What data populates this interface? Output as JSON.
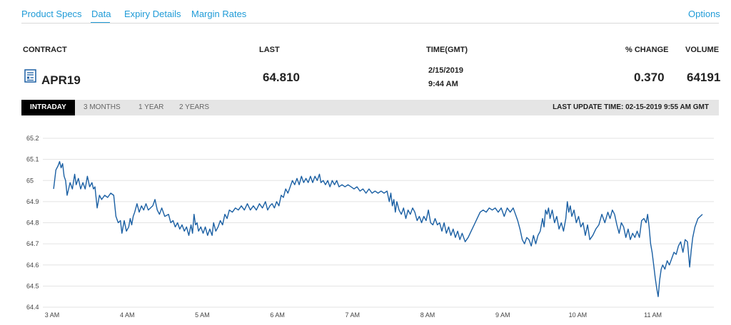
{
  "tabs": [
    {
      "label": "Product Specs"
    },
    {
      "label": "Data",
      "active": true
    },
    {
      "label": "Expiry Details"
    },
    {
      "label": "Margin Rates"
    }
  ],
  "options_label": "Options",
  "table": {
    "headers": {
      "contract": "CONTRACT",
      "last": "LAST",
      "time": "TIME(GMT)",
      "change": "% CHANGE",
      "volume": "VOLUME"
    },
    "row": {
      "contract": "APR19",
      "last": "64.810",
      "date": "2/15/2019",
      "time": "9:44 AM",
      "change": "0.370",
      "volume": "64191"
    },
    "contract_icon": "document-list-icon"
  },
  "ranges": [
    {
      "label": "INTRADAY",
      "active": true
    },
    {
      "label": "3 MONTHS"
    },
    {
      "label": "1 YEAR"
    },
    {
      "label": "2 YEARS"
    }
  ],
  "last_update": "LAST UPDATE TIME: 02-15-2019 9:55 AM GMT",
  "colors": {
    "accent": "#1f9bd7",
    "line": "#1a5fa3",
    "grid": "#e3e3e3"
  },
  "chart_data": {
    "type": "line",
    "y_ticks": [
      "65.2",
      "65.1",
      "65",
      "64.9",
      "64.8",
      "64.7",
      "64.6",
      "64.5",
      "64.4"
    ],
    "x_ticks": [
      "3 AM",
      "4 AM",
      "5 AM",
      "6 AM",
      "7 AM",
      "8 AM",
      "9 AM",
      "10 AM",
      "11 AM"
    ],
    "ylim": [
      64.4,
      65.2
    ],
    "xlim_hours": [
      3.0,
      11.85
    ],
    "grid": "horizontal",
    "series": [
      {
        "points": [
          [
            3.02,
            64.96
          ],
          [
            3.05,
            65.05
          ],
          [
            3.08,
            65.07
          ],
          [
            3.1,
            65.09
          ],
          [
            3.12,
            65.06
          ],
          [
            3.14,
            65.08
          ],
          [
            3.16,
            65.02
          ],
          [
            3.18,
            65.0
          ],
          [
            3.2,
            64.93
          ],
          [
            3.22,
            64.96
          ],
          [
            3.24,
            64.99
          ],
          [
            3.27,
            64.96
          ],
          [
            3.3,
            65.03
          ],
          [
            3.32,
            64.98
          ],
          [
            3.35,
            65.01
          ],
          [
            3.38,
            64.96
          ],
          [
            3.41,
            64.99
          ],
          [
            3.44,
            64.96
          ],
          [
            3.47,
            65.02
          ],
          [
            3.5,
            64.97
          ],
          [
            3.53,
            64.99
          ],
          [
            3.55,
            64.96
          ],
          [
            3.57,
            64.97
          ],
          [
            3.6,
            64.87
          ],
          [
            3.63,
            64.93
          ],
          [
            3.66,
            64.91
          ],
          [
            3.7,
            64.93
          ],
          [
            3.74,
            64.92
          ],
          [
            3.78,
            64.94
          ],
          [
            3.82,
            64.93
          ],
          [
            3.85,
            64.83
          ],
          [
            3.88,
            64.8
          ],
          [
            3.91,
            64.81
          ],
          [
            3.93,
            64.75
          ],
          [
            3.96,
            64.81
          ],
          [
            3.99,
            64.76
          ],
          [
            4.02,
            64.78
          ],
          [
            4.04,
            64.82
          ],
          [
            4.06,
            64.79
          ],
          [
            4.08,
            64.83
          ],
          [
            4.1,
            64.85
          ],
          [
            4.13,
            64.89
          ],
          [
            4.16,
            64.85
          ],
          [
            4.19,
            64.88
          ],
          [
            4.22,
            64.86
          ],
          [
            4.25,
            64.89
          ],
          [
            4.28,
            64.86
          ],
          [
            4.31,
            64.87
          ],
          [
            4.34,
            64.88
          ],
          [
            4.37,
            64.91
          ],
          [
            4.4,
            64.86
          ],
          [
            4.43,
            64.84
          ],
          [
            4.46,
            64.87
          ],
          [
            4.5,
            64.83
          ],
          [
            4.55,
            64.84
          ],
          [
            4.58,
            64.8
          ],
          [
            4.61,
            64.81
          ],
          [
            4.64,
            64.78
          ],
          [
            4.67,
            64.8
          ],
          [
            4.7,
            64.77
          ],
          [
            4.73,
            64.79
          ],
          [
            4.76,
            64.76
          ],
          [
            4.79,
            64.78
          ],
          [
            4.82,
            64.74
          ],
          [
            4.85,
            64.79
          ],
          [
            4.87,
            64.75
          ],
          [
            4.89,
            64.84
          ],
          [
            4.91,
            64.79
          ],
          [
            4.93,
            64.8
          ],
          [
            4.95,
            64.76
          ],
          [
            4.98,
            64.78
          ],
          [
            5.01,
            64.75
          ],
          [
            5.04,
            64.78
          ],
          [
            5.07,
            64.74
          ],
          [
            5.1,
            64.77
          ],
          [
            5.13,
            64.74
          ],
          [
            5.15,
            64.8
          ],
          [
            5.18,
            64.76
          ],
          [
            5.21,
            64.78
          ],
          [
            5.24,
            64.81
          ],
          [
            5.27,
            64.79
          ],
          [
            5.3,
            64.84
          ],
          [
            5.33,
            64.82
          ],
          [
            5.36,
            64.86
          ],
          [
            5.4,
            64.85
          ],
          [
            5.44,
            64.87
          ],
          [
            5.48,
            64.86
          ],
          [
            5.52,
            64.88
          ],
          [
            5.56,
            64.86
          ],
          [
            5.6,
            64.89
          ],
          [
            5.64,
            64.86
          ],
          [
            5.68,
            64.88
          ],
          [
            5.72,
            64.86
          ],
          [
            5.76,
            64.89
          ],
          [
            5.8,
            64.87
          ],
          [
            5.84,
            64.9
          ],
          [
            5.87,
            64.86
          ],
          [
            5.9,
            64.88
          ],
          [
            5.93,
            64.89
          ],
          [
            5.96,
            64.87
          ],
          [
            5.99,
            64.9
          ],
          [
            6.02,
            64.88
          ],
          [
            6.05,
            64.93
          ],
          [
            6.08,
            64.92
          ],
          [
            6.11,
            64.96
          ],
          [
            6.14,
            64.94
          ],
          [
            6.17,
            64.97
          ],
          [
            6.2,
            65.0
          ],
          [
            6.23,
            64.98
          ],
          [
            6.26,
            65.01
          ],
          [
            6.29,
            64.98
          ],
          [
            6.32,
            65.02
          ],
          [
            6.35,
            64.99
          ],
          [
            6.38,
            65.01
          ],
          [
            6.41,
            64.99
          ],
          [
            6.44,
            65.02
          ],
          [
            6.47,
            64.99
          ],
          [
            6.5,
            65.02
          ],
          [
            6.53,
            65.0
          ],
          [
            6.56,
            65.03
          ],
          [
            6.58,
            64.99
          ],
          [
            6.61,
            65.0
          ],
          [
            6.64,
            64.98
          ],
          [
            6.67,
            65.0
          ],
          [
            6.7,
            64.97
          ],
          [
            6.73,
            65.0
          ],
          [
            6.76,
            64.98
          ],
          [
            6.79,
            65.0
          ],
          [
            6.82,
            64.97
          ],
          [
            6.86,
            64.98
          ],
          [
            6.9,
            64.97
          ],
          [
            6.94,
            64.98
          ],
          [
            6.98,
            64.97
          ],
          [
            7.02,
            64.96
          ],
          [
            7.06,
            64.97
          ],
          [
            7.1,
            64.95
          ],
          [
            7.14,
            64.96
          ],
          [
            7.18,
            64.94
          ],
          [
            7.22,
            64.96
          ],
          [
            7.26,
            64.94
          ],
          [
            7.3,
            64.95
          ],
          [
            7.34,
            64.94
          ],
          [
            7.38,
            64.95
          ],
          [
            7.42,
            64.94
          ],
          [
            7.46,
            64.95
          ],
          [
            7.49,
            64.9
          ],
          [
            7.51,
            64.94
          ],
          [
            7.53,
            64.88
          ],
          [
            7.55,
            64.91
          ],
          [
            7.57,
            64.85
          ],
          [
            7.59,
            64.9
          ],
          [
            7.62,
            64.86
          ],
          [
            7.65,
            64.84
          ],
          [
            7.68,
            64.87
          ],
          [
            7.71,
            64.82
          ],
          [
            7.74,
            64.86
          ],
          [
            7.77,
            64.84
          ],
          [
            7.8,
            64.87
          ],
          [
            7.83,
            64.85
          ],
          [
            7.86,
            64.81
          ],
          [
            7.89,
            64.83
          ],
          [
            7.92,
            64.8
          ],
          [
            7.95,
            64.83
          ],
          [
            7.98,
            64.81
          ],
          [
            8.01,
            64.86
          ],
          [
            8.04,
            64.8
          ],
          [
            8.07,
            64.79
          ],
          [
            8.1,
            64.82
          ],
          [
            8.13,
            64.79
          ],
          [
            8.16,
            64.8
          ],
          [
            8.19,
            64.76
          ],
          [
            8.22,
            64.8
          ],
          [
            8.25,
            64.75
          ],
          [
            8.28,
            64.78
          ],
          [
            8.31,
            64.74
          ],
          [
            8.34,
            64.77
          ],
          [
            8.37,
            64.73
          ],
          [
            8.4,
            64.76
          ],
          [
            8.43,
            64.72
          ],
          [
            8.46,
            64.75
          ],
          [
            8.5,
            64.71
          ],
          [
            8.54,
            64.73
          ],
          [
            8.58,
            64.76
          ],
          [
            8.62,
            64.79
          ],
          [
            8.66,
            64.82
          ],
          [
            8.7,
            64.85
          ],
          [
            8.74,
            64.86
          ],
          [
            8.78,
            64.85
          ],
          [
            8.82,
            64.87
          ],
          [
            8.86,
            64.86
          ],
          [
            8.9,
            64.87
          ],
          [
            8.94,
            64.85
          ],
          [
            8.98,
            64.87
          ],
          [
            9.02,
            64.83
          ],
          [
            9.06,
            64.87
          ],
          [
            9.1,
            64.85
          ],
          [
            9.14,
            64.87
          ],
          [
            9.17,
            64.84
          ],
          [
            9.2,
            64.81
          ],
          [
            9.23,
            64.77
          ],
          [
            9.26,
            64.72
          ],
          [
            9.29,
            64.7
          ],
          [
            9.32,
            64.73
          ],
          [
            9.35,
            64.72
          ],
          [
            9.38,
            64.69
          ],
          [
            9.41,
            64.74
          ],
          [
            9.44,
            64.7
          ],
          [
            9.47,
            64.74
          ],
          [
            9.5,
            64.76
          ],
          [
            9.53,
            64.82
          ],
          [
            9.55,
            64.78
          ],
          [
            9.57,
            64.86
          ],
          [
            9.59,
            64.84
          ],
          [
            9.61,
            64.87
          ],
          [
            9.63,
            64.82
          ],
          [
            9.66,
            64.86
          ],
          [
            9.69,
            64.8
          ],
          [
            9.72,
            64.83
          ],
          [
            9.75,
            64.77
          ],
          [
            9.78,
            64.8
          ],
          [
            9.81,
            64.76
          ],
          [
            9.84,
            64.82
          ],
          [
            9.86,
            64.9
          ],
          [
            9.88,
            64.85
          ],
          [
            9.9,
            64.88
          ],
          [
            9.92,
            64.83
          ],
          [
            9.95,
            64.86
          ],
          [
            9.98,
            64.8
          ],
          [
            10.01,
            64.83
          ],
          [
            10.04,
            64.78
          ],
          [
            10.07,
            64.8
          ],
          [
            10.1,
            64.74
          ],
          [
            10.13,
            64.79
          ],
          [
            10.16,
            64.72
          ],
          [
            10.2,
            64.74
          ],
          [
            10.24,
            64.77
          ],
          [
            10.28,
            64.79
          ],
          [
            10.32,
            64.84
          ],
          [
            10.36,
            64.8
          ],
          [
            10.4,
            64.85
          ],
          [
            10.43,
            64.82
          ],
          [
            10.46,
            64.86
          ],
          [
            10.49,
            64.84
          ]
        ]
      },
      {
        "points": [
          [
            10.49,
            64.84
          ],
          [
            10.52,
            64.79
          ],
          [
            10.55,
            64.75
          ],
          [
            10.58,
            64.8
          ],
          [
            10.61,
            64.78
          ],
          [
            10.64,
            64.73
          ],
          [
            10.67,
            64.77
          ],
          [
            10.7,
            64.72
          ],
          [
            10.73,
            64.75
          ],
          [
            10.76,
            64.73
          ],
          [
            10.79,
            64.76
          ],
          [
            10.82,
            64.73
          ],
          [
            10.85,
            64.81
          ],
          [
            10.88,
            64.82
          ],
          [
            10.91,
            64.8
          ],
          [
            10.93,
            64.84
          ],
          [
            10.95,
            64.78
          ],
          [
            10.97,
            64.7
          ],
          [
            10.99,
            64.66
          ],
          [
            11.01,
            64.6
          ],
          [
            11.03,
            64.54
          ],
          [
            11.05,
            64.49
          ],
          [
            11.07,
            64.45
          ],
          [
            11.09,
            64.53
          ],
          [
            11.11,
            64.58
          ],
          [
            11.13,
            64.6
          ],
          [
            11.16,
            64.58
          ],
          [
            11.19,
            64.62
          ],
          [
            11.22,
            64.6
          ],
          [
            11.25,
            64.63
          ],
          [
            11.28,
            64.66
          ],
          [
            11.31,
            64.65
          ],
          [
            11.34,
            64.69
          ],
          [
            11.37,
            64.71
          ],
          [
            11.4,
            64.66
          ],
          [
            11.43,
            64.72
          ],
          [
            11.46,
            64.71
          ],
          [
            11.49,
            64.59
          ],
          [
            11.51,
            64.67
          ],
          [
            11.53,
            64.73
          ],
          [
            11.56,
            64.78
          ],
          [
            11.6,
            64.82
          ],
          [
            11.63,
            64.83
          ],
          [
            11.66,
            64.84
          ]
        ]
      }
    ]
  }
}
